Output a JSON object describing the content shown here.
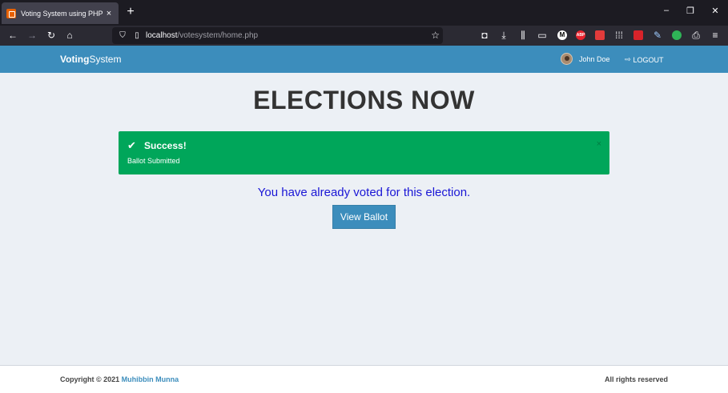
{
  "browser": {
    "tab_title": "Voting System using PHP",
    "tab_close": "×",
    "new_tab": "+",
    "url_host": "localhost",
    "url_path": "/votesystem/home.php",
    "window_buttons": [
      "–",
      "❐",
      "✕"
    ],
    "nav_icons": [
      "back-icon",
      "forward-icon",
      "reload-icon",
      "home-icon"
    ],
    "extensions": [
      {
        "name": "pocket-icon",
        "color": "#fbfbfe"
      },
      {
        "name": "downloads-icon",
        "color": "#fbfbfe"
      },
      {
        "name": "library-icon",
        "color": "#fbfbfe"
      },
      {
        "name": "sidebar-icon",
        "color": "#fbfbfe"
      },
      {
        "name": "m-extension-icon",
        "color": "#ffffff"
      },
      {
        "name": "adblock-icon",
        "color": "#e8222d"
      },
      {
        "name": "camera-extension-icon",
        "color": "#e23b3b"
      },
      {
        "name": "grid-extension-icon",
        "color": "#fbfbfe"
      },
      {
        "name": "red-extension-icon",
        "color": "#d8232a"
      },
      {
        "name": "pen-extension-icon",
        "color": "#9ecbff"
      },
      {
        "name": "green-extension-icon",
        "color": "#2fb457"
      },
      {
        "name": "printer-extension-icon",
        "color": "#fbfbfe"
      },
      {
        "name": "menu-icon",
        "color": "#fbfbfe"
      }
    ]
  },
  "header": {
    "brand_bold": "Voting",
    "brand_rest": "System",
    "user_name": "John Doe",
    "logout_label": "LOGOUT",
    "accent": "#3c8dbc"
  },
  "main": {
    "title": "ELECTIONS NOW",
    "alert": {
      "title": "Success!",
      "message": "Ballot Submitted",
      "close": "×",
      "color": "#00a65a"
    },
    "voted_message": "You have already voted for this election.",
    "view_ballot_label": "View Ballot"
  },
  "footer": {
    "copyright_prefix": "Copyright © 2021",
    "author": "Muhibbin Munna",
    "rights": "All rights reserved"
  }
}
